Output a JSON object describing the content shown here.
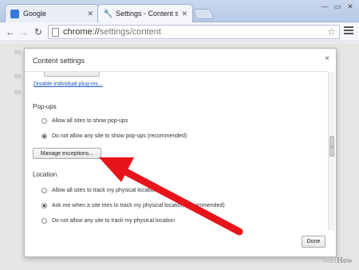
{
  "tabs": [
    {
      "label": "Google",
      "favicon_color": "#3a78d8"
    },
    {
      "label": "Settings - Content settings"
    }
  ],
  "toolbar": {
    "url_scheme": "chrome://",
    "url_path": "settings/content"
  },
  "dialog": {
    "title": "Content settings",
    "close": "×",
    "plugins_link": "Disable individual plug-ins...",
    "popups": {
      "heading": "Pop-ups",
      "options": [
        {
          "label": "Allow all sites to show pop-ups",
          "selected": false
        },
        {
          "label": "Do not allow any site to show pop-ups (recommended)",
          "selected": true
        }
      ],
      "manage_button": "Manage exceptions..."
    },
    "location": {
      "heading": "Location",
      "options": [
        {
          "label": "Allow all sites to track my physical location",
          "selected": false
        },
        {
          "label": "Ask me when a site tries to track my physical location (recommended)",
          "selected": true
        },
        {
          "label": "Do not allow any site to track my physical location",
          "selected": false
        }
      ]
    },
    "done_button": "Done"
  },
  "annotation": {
    "arrow_color": "#e8141c"
  },
  "watermark": {
    "brand": "wiki",
    "suffix": "How"
  }
}
